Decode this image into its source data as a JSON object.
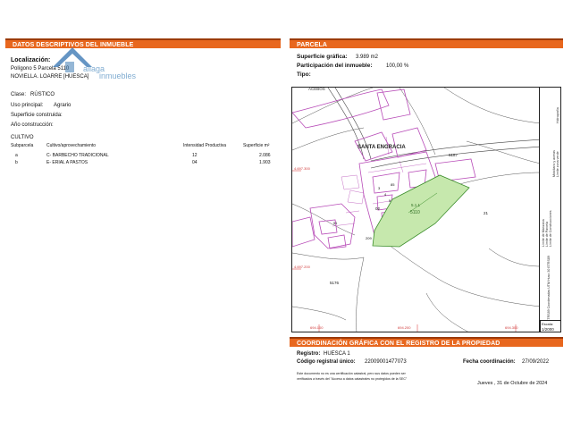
{
  "left": {
    "header": "DATOS DESCRIPTIVOS DEL INMUEBLE",
    "localizacion_label": "Localización:",
    "localizacion_line1": "Polígono 5 Parcela 5110",
    "localizacion_line2": "NOVIELLA. LOARRE [HUESCA]",
    "clase_label": "Clase:",
    "clase_value": "RÚSTICO",
    "uso_label": "Uso principal:",
    "uso_value": "Agrario",
    "superficie_label": "Superficie construida:",
    "anio_label": "Año construcción:",
    "cultivo_title": "CULTIVO",
    "cols": {
      "subparcela": "Subparcela",
      "cultivo": "Cultivo/aprovechamiento",
      "intensidad": "Intensidad Productiva",
      "superficie": "Superficie m²"
    },
    "rows": [
      {
        "sub": "a",
        "cultivo": "C- BARBECHO TRADICIONAL",
        "intensidad": "12",
        "superficie": "2.086"
      },
      {
        "sub": "b",
        "cultivo": "E- ERIAL A PASTOS",
        "intensidad": "04",
        "superficie": "1.903"
      }
    ]
  },
  "watermark": {
    "brand_a": "aliaga",
    "brand_b": "inmuebles"
  },
  "right": {
    "header": "PARCELA",
    "superficie_label": "Superficie gráfica:",
    "superficie_value": "3.989 m2",
    "participacion_label": "Participación del inmueble:",
    "participacion_value": "100,00 %",
    "tipo_label": "Tipo:",
    "map": {
      "place": "SANTA  ENGRACIA",
      "top_label": "ACEBOS",
      "parcel_main": "5110",
      "parcel_sub": "5.1.1",
      "labels": [
        "5187",
        "21",
        "5176",
        "02",
        "3",
        "4",
        "5",
        "85",
        "209",
        "51"
      ],
      "coord_y1": "4.697.300",
      "coord_y2": "4.697.200",
      "coord_x1": "694.100",
      "coord_x2": "694.200",
      "coord_x3": "694.300"
    },
    "legend": [
      "Límite de Manzana",
      "Límite de Parcela",
      "Límite de Construcciones",
      "Mobiliario y aceras",
      "Límite zona verde",
      "Hidrografía"
    ],
    "legend_bottom": "ETRS89 Coordenadas UTM Huso 30 ETRS89",
    "escala_label": "Escala:",
    "escala_value": "1/2000"
  },
  "coord": {
    "header": "COORDINACIÓN GRÁFICA CON EL REGISTRO DE LA PROPIEDAD",
    "registro_label": "Registro:",
    "registro_value": "HUESCA 1",
    "codigo_label": "Código registral único:",
    "codigo_value": "22009001477073",
    "fecha_label": "Fecha coordinación:",
    "fecha_value": "27/09/2022",
    "note_line1": "Este documento no es una certificación catastral, pero sus datos pueden ser",
    "note_line2": "verificados a través del \"Acceso a datos catastrales no protegidos de la SEC\"",
    "date": "Jueves , 31 de Octubre de 2024"
  },
  "colors": {
    "accent": "#e8671e",
    "accent_dark": "#9c3a06",
    "parcel_fill": "#c6e8ad",
    "parcel_stroke": "#3a8d2a",
    "boundary": "#b84cb8"
  }
}
